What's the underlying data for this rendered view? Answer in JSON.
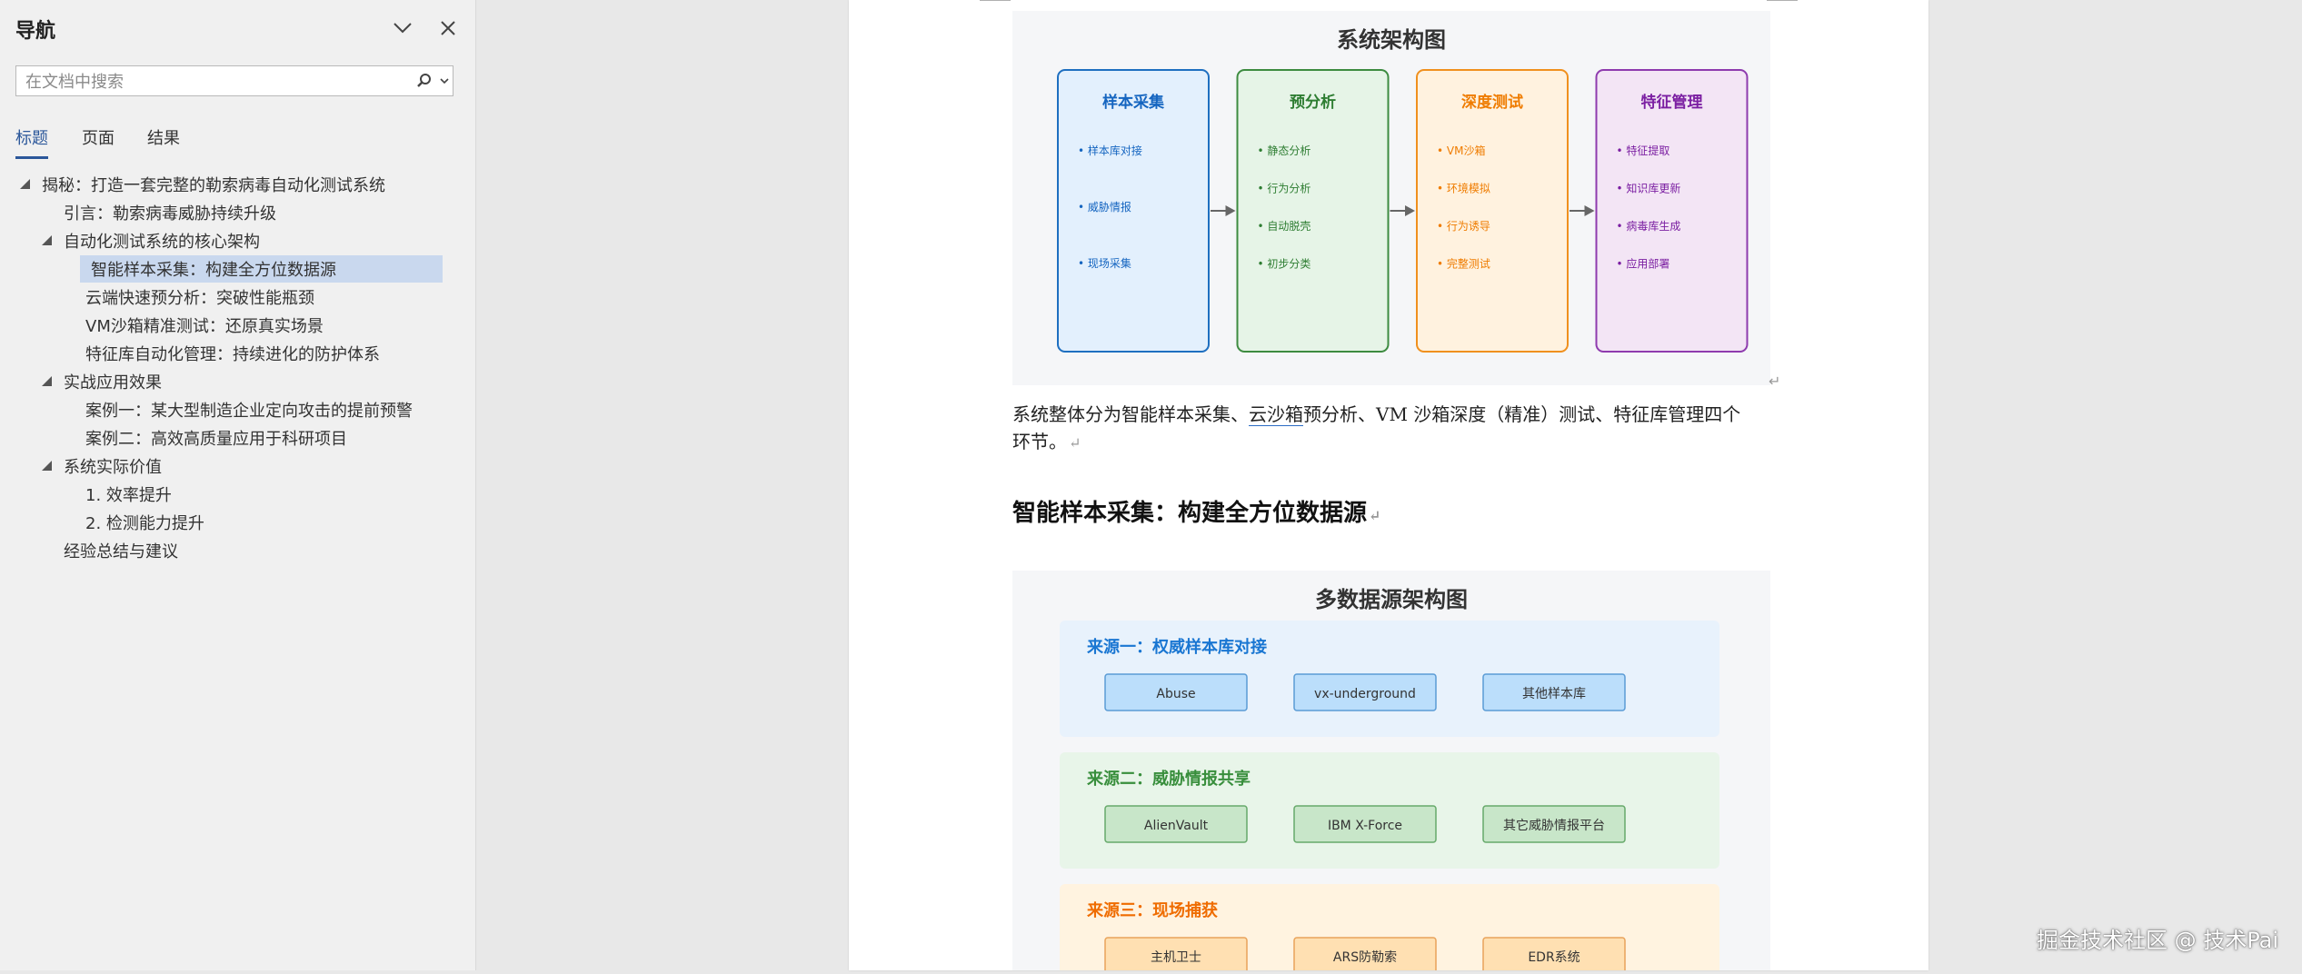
{
  "nav": {
    "title": "导航",
    "search_placeholder": "在文档中搜索",
    "tabs": [
      {
        "label": "标题",
        "active": true
      },
      {
        "label": "页面",
        "active": false
      },
      {
        "label": "结果",
        "active": false
      }
    ],
    "tree": [
      {
        "label": "揭秘：打造一套完整的勒索病毒自动化测试系统",
        "level": 1,
        "expanded": true
      },
      {
        "label": "引言：勒索病毒威胁持续升级",
        "level": 2,
        "expanded": null
      },
      {
        "label": "自动化测试系统的核心架构",
        "level": 2,
        "expanded": true
      },
      {
        "label": "智能样本采集：构建全方位数据源",
        "level": 3,
        "selected": true
      },
      {
        "label": "云端快速预分析：突破性能瓶颈",
        "level": 3
      },
      {
        "label": "VM沙箱精准测试：还原真实场景",
        "level": 3
      },
      {
        "label": "特征库自动化管理：持续进化的防护体系",
        "level": 3
      },
      {
        "label": "实战应用效果",
        "level": 2,
        "expanded": true
      },
      {
        "label": "案例一：某大型制造企业定向攻击的提前预警",
        "level": 3
      },
      {
        "label": "案例二：高效高质量应用于科研项目",
        "level": 3
      },
      {
        "label": "系统实际价值",
        "level": 2,
        "expanded": true
      },
      {
        "label": "1. 效率提升",
        "level": 3
      },
      {
        "label": "2. 检测能力提升",
        "level": 3
      },
      {
        "label": "经验总结与建议",
        "level": 2
      }
    ]
  },
  "doc": {
    "fig1": {
      "title": "系统架构图",
      "stages": [
        {
          "name": "样本采集",
          "color": "#1565c0",
          "border": "#1e6fc0",
          "fill": "#e3f0fd",
          "items": [
            "样本库对接",
            "威胁情报",
            "现场采集"
          ]
        },
        {
          "name": "预分析",
          "color": "#2e7d32",
          "border": "#3d8b40",
          "fill": "#e6f4e7",
          "items": [
            "静态分析",
            "行为分析",
            "自动脱壳",
            "初步分类"
          ]
        },
        {
          "name": "深度测试",
          "color": "#ef7c00",
          "border": "#f0901e",
          "fill": "#fff2df",
          "items": [
            "VM沙箱",
            "环境模拟",
            "行为诱导",
            "完整测试"
          ]
        },
        {
          "name": "特征管理",
          "color": "#7b1fa2",
          "border": "#8e3bae",
          "fill": "#f3e5f5",
          "items": [
            "特征提取",
            "知识库更新",
            "病毒库生成",
            "应用部署"
          ]
        }
      ]
    },
    "paragraph1_line1_a": "系统整体分为智能样本采集、",
    "paragraph1_line1_link": "云沙箱",
    "paragraph1_line1_b": "预分析、VM 沙箱深度（精准）测试、特征库管理四个",
    "paragraph1_line2": "环节。",
    "heading1": "智能样本采集：构建全方位数据源",
    "fig2": {
      "title": "多数据源架构图",
      "sources": [
        {
          "label": "来源一：权威样本库对接",
          "color": "#1976d2",
          "bg": "#e8f2fc",
          "box_fill": "#bbdefb",
          "box_border": "#5a9bd5",
          "items": [
            "Abuse",
            "vx-underground",
            "其他样本库"
          ]
        },
        {
          "label": "来源二：威胁情报共享",
          "color": "#388e3c",
          "bg": "#e8f5e9",
          "box_fill": "#c8e6c9",
          "box_border": "#66a96a",
          "items": [
            "AlienVault",
            "IBM X-Force",
            "其它威胁情报平台"
          ]
        },
        {
          "label": "来源三：现场捕获",
          "color": "#ef6c00",
          "bg": "#fff3e0",
          "box_fill": "#ffe0b2",
          "box_border": "#e8a25a",
          "items": [
            "主机卫士",
            "ARS防勒索",
            "EDR系统"
          ]
        }
      ]
    },
    "watermark": "掘金技术社区 @ 技术Pai"
  }
}
